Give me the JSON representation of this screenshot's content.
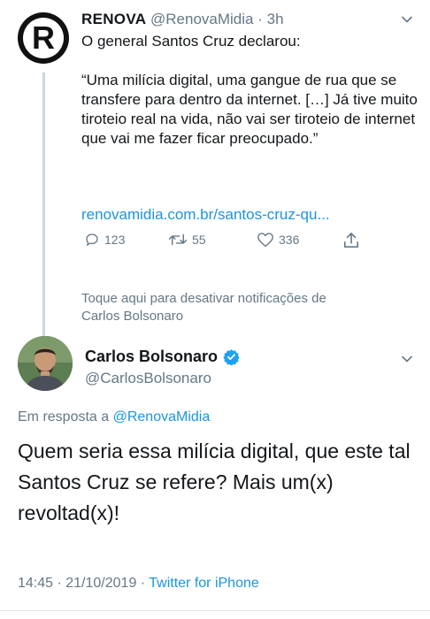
{
  "parent_tweet": {
    "display_name": "RENOVA",
    "handle": "@RenovaMidia",
    "separator": "·",
    "time": "3h",
    "text": "O general Santos Cruz declarou:\n\n“Uma milícia digital, uma gangue de rua que se transfere para dentro da internet. […] Já tive muito tiroteio real na vida, não vai ser tiroteio de internet que vai me fazer ficar preocupado.”",
    "link": "renovamidia.com.br/santos-cruz-qu...",
    "replies": "123",
    "retweets": "55",
    "likes": "336"
  },
  "notification_toggle": "Toque aqui para desativar notificações de\nCarlos Bolsonaro",
  "main_tweet": {
    "display_name": "Carlos Bolsonaro",
    "handle": "@CarlosBolsonaro",
    "reply_prefix": "Em resposta a ",
    "reply_to": "@RenovaMidia",
    "text": "Quem seria essa milícia digital, que este tal Santos Cruz se refere? Mais um(x) revoltad(x)!",
    "timestamp": "14:45 · 21/10/2019 · ",
    "source": "Twitter for iPhone"
  },
  "colors": {
    "link_blue": "#1b95e0",
    "muted_gray": "#657786",
    "verified_blue": "#1da1f2",
    "thread_line": "#ccd6dd"
  },
  "icons": [
    "renova-logo",
    "chevron-down-icon",
    "reply-icon",
    "retweet-icon",
    "like-icon",
    "share-icon",
    "verified-badge-icon"
  ]
}
